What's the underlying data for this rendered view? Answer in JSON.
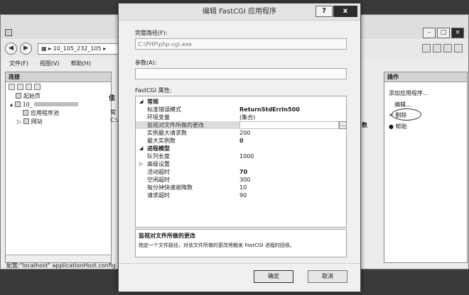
{
  "iis": {
    "address": "10_105_232_105",
    "menu": [
      "文件(F)",
      "视图(V)",
      "帮助(H)"
    ],
    "connections_title": "连接",
    "tree": [
      "起始页",
      "10_",
      "应用程序池",
      "网站"
    ],
    "status": "配置:\"localhost\" applicationHost.config",
    "mid_labels": [
      "佳",
      "常",
      "C:\\"
    ],
    "sliver": "数",
    "actions_title": "操作",
    "actions": {
      "add": "添加应用程序...",
      "edit": "编辑...",
      "delete": "删除",
      "help": "帮助"
    }
  },
  "dialog": {
    "title": "编辑 FastCGI 应用程序",
    "help_btn": "?",
    "close_btn": "x",
    "full_path_label": "完整路径(F):",
    "full_path_value": "C:\\PHP\\php-cgi.exe",
    "args_label": "参数(A):",
    "args_value": "",
    "props_label": "FastCGI 属性:",
    "categories": {
      "general": "常规",
      "process": "进程模型"
    },
    "rows": {
      "stderr_mode": {
        "name": "标准错误模式",
        "value": "ReturnStdErrIn500"
      },
      "env_vars": {
        "name": "环境变量",
        "value": "(集合)"
      },
      "monitor": {
        "name": "监视对文件所做的更改",
        "value": ""
      },
      "max_requests": {
        "name": "实例最大请求数",
        "value": "200"
      },
      "max_instances": {
        "name": "最大实例数",
        "value": "0"
      },
      "queue_length": {
        "name": "队列长度",
        "value": "1000"
      },
      "advanced": {
        "name": "高级设置",
        "value": ""
      },
      "activity_timeout": {
        "name": "活动超时",
        "value": "70"
      },
      "idle_timeout": {
        "name": "空闲超时",
        "value": "300"
      },
      "rapid_fails": {
        "name": "每分钟快速故障数",
        "value": "10"
      },
      "request_timeout": {
        "name": "请求超时",
        "value": "90"
      }
    },
    "desc_title": "监视对文件所做的更改",
    "desc_text": "指定一个文件路径，对该文件所做的更改将触发 FastCGI 进程的回收。",
    "ok": "确定",
    "cancel": "取消"
  },
  "colors": {
    "title_bar": "#e4e4e4",
    "selection": "#dcdcdc",
    "dark_button": "#2b2b2b"
  }
}
